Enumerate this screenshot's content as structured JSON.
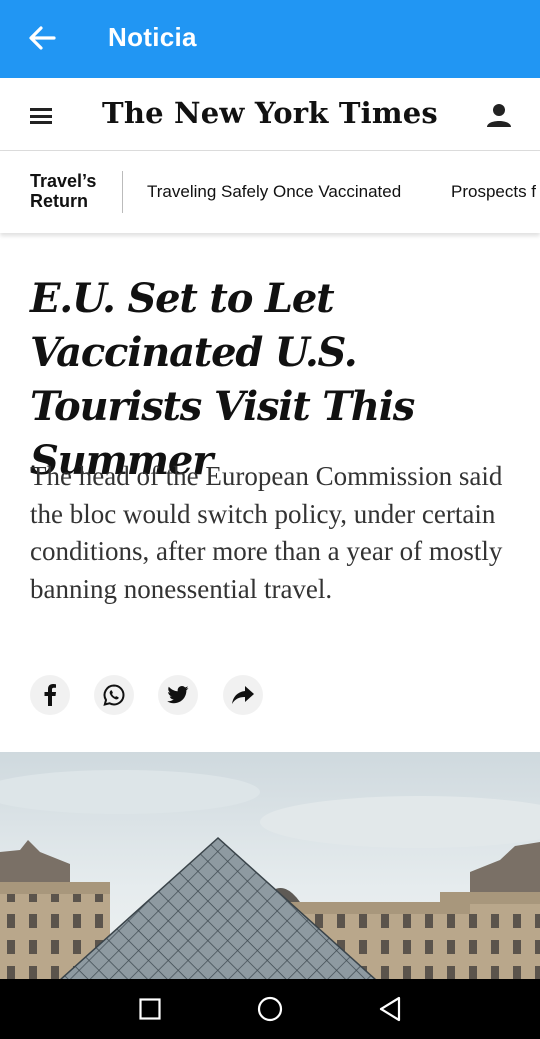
{
  "app_bar": {
    "title": "Noticia",
    "icon": "arrow-left-icon",
    "color": "#2196f3"
  },
  "masthead": {
    "logo": "The New York Times",
    "menu_icon": "hamburger-menu-icon",
    "user_icon": "account-icon"
  },
  "topic_bar": {
    "section_label_line1": "Travel’s",
    "section_label_line2": "Return",
    "links": [
      "Traveling Safely Once Vaccinated",
      "Prospects f"
    ]
  },
  "article": {
    "headline": "E.U. Set to Let Vaccinated U.S. Tourists Visit This Summer",
    "summary": "The head of the European Commission said the bloc would switch policy, under certain conditions, after more than a year of mostly banning nonessential travel."
  },
  "share_buttons": [
    {
      "icon": "facebook-icon"
    },
    {
      "icon": "whatsapp-icon"
    },
    {
      "icon": "twitter-icon"
    },
    {
      "icon": "share-icon"
    }
  ],
  "system_nav": {
    "buttons": [
      "recents-square-icon",
      "home-circle-icon",
      "back-triangle-icon"
    ]
  }
}
